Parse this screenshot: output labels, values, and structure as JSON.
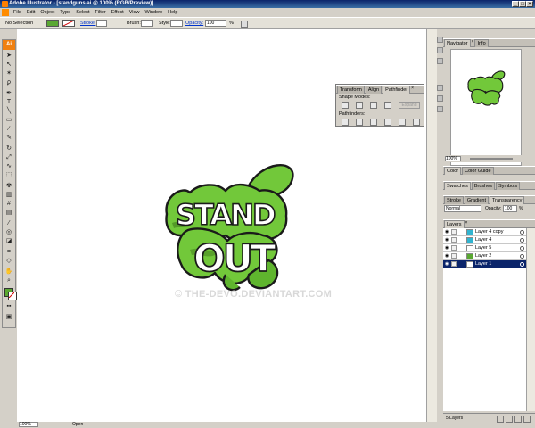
{
  "window": {
    "title": "Adobe Illustrator - [standguns.ai @ 100% (RGB/Preview)]"
  },
  "menu": [
    "File",
    "Edit",
    "Object",
    "Type",
    "Select",
    "Filter",
    "Effect",
    "View",
    "Window",
    "Help"
  ],
  "control_bar": {
    "selection_label": "No Selection",
    "stroke_label": "Stroke:",
    "brush_label": "Brush:",
    "style_label": "Style:",
    "opacity_label": "Opacity:",
    "opacity_value": "100",
    "opacity_unit": "%",
    "fill_color": "#5aa832"
  },
  "toolbar": {
    "logo": "Ai"
  },
  "artwork": {
    "line1": "STAND",
    "line2": "OUT",
    "color": "#72c83a",
    "dark": "#3f7a1c"
  },
  "watermark": "© THE-DEVO.DEVIANTART.COM",
  "status_bar": {
    "zoom": "100%",
    "file_state": "Open"
  },
  "pathfinder_panel": {
    "tabs": [
      "Transform",
      "Align",
      "Pathfinder"
    ],
    "shape_modes_label": "Shape Modes:",
    "expand_label": "Expand",
    "pathfinders_label": "Pathfinders:"
  },
  "navigator_panel": {
    "tabs": [
      "Navigator",
      "Info"
    ],
    "zoom": "100%"
  },
  "color_panel": {
    "tabs": [
      "Color",
      "Color Guide"
    ]
  },
  "swatches_panel": {
    "tabs": [
      "Swatches",
      "Brushes",
      "Symbols"
    ]
  },
  "stroke_panel": {
    "tabs": [
      "Stroke",
      "Gradient",
      "Transparency"
    ],
    "blend_mode": "Normal",
    "opacity_label": "Opacity:",
    "opacity_value": "100",
    "opacity_unit": "%"
  },
  "layers_panel": {
    "tab": "Layers",
    "layers": [
      {
        "name": "Layer 4 copy",
        "color": "#31b4d0",
        "selected": false
      },
      {
        "name": "Layer 4",
        "color": "#31b4d0",
        "selected": false
      },
      {
        "name": "Layer 5",
        "color": "#ffffff",
        "selected": false
      },
      {
        "name": "Layer 2",
        "color": "#5aa832",
        "selected": false
      },
      {
        "name": "Layer 1",
        "color": "#0a246a",
        "selected": true
      }
    ],
    "footer": "5 Layers"
  }
}
